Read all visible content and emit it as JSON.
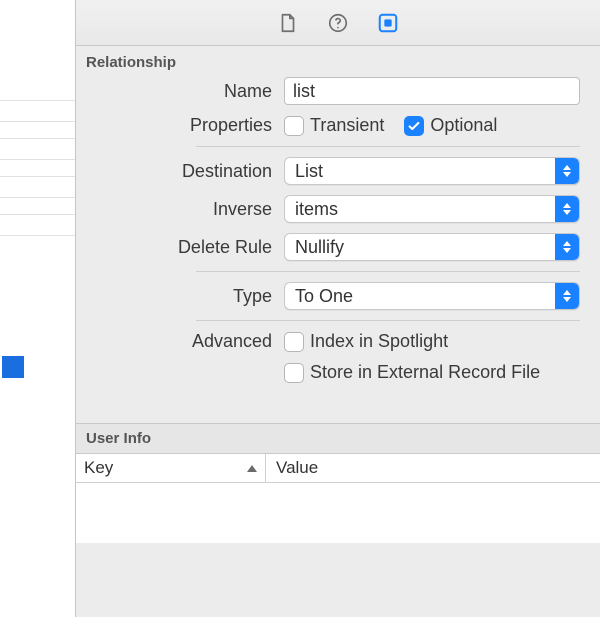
{
  "section_title": "Relationship",
  "labels": {
    "name": "Name",
    "properties": "Properties",
    "transient": "Transient",
    "optional": "Optional",
    "destination": "Destination",
    "inverse": "Inverse",
    "delete_rule": "Delete Rule",
    "type": "Type",
    "advanced": "Advanced",
    "index_spotlight": "Index in Spotlight",
    "store_external": "Store in External Record File"
  },
  "values": {
    "name": "list",
    "destination": "List",
    "inverse": "items",
    "delete_rule": "Nullify",
    "type": "To One"
  },
  "properties": {
    "transient": false,
    "optional": true
  },
  "advanced": {
    "index_spotlight": false,
    "store_external": false
  },
  "user_info": {
    "heading": "User Info",
    "columns": {
      "key": "Key",
      "value": "Value"
    }
  }
}
